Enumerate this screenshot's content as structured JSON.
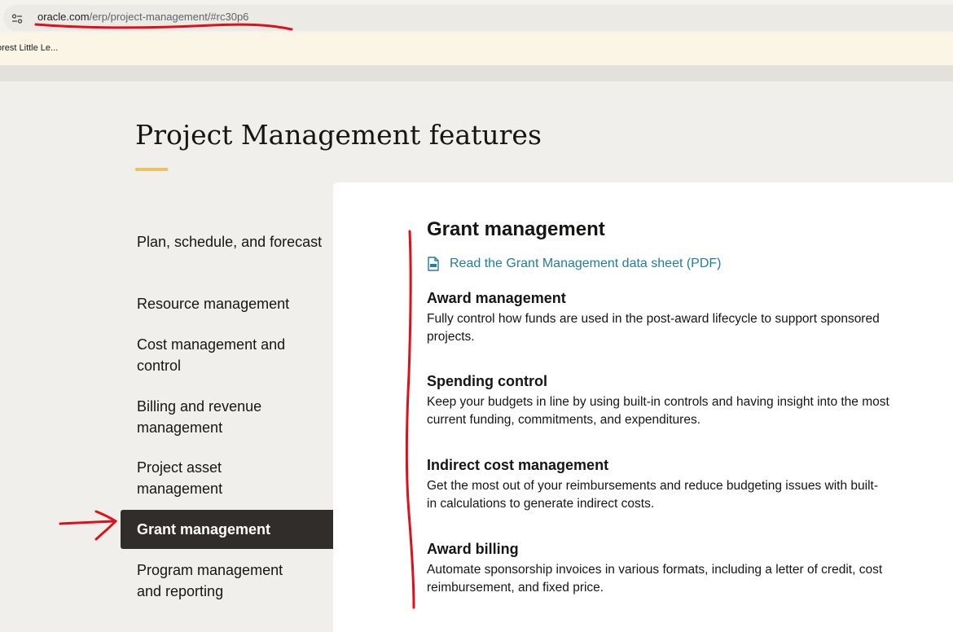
{
  "browser": {
    "url_host": "oracle.com",
    "url_path": "/erp/project-management/#rc30p6",
    "bookmark_label": "orest Little Le..."
  },
  "page": {
    "title": "Project Management features",
    "accent_color": "#e9c460"
  },
  "nav": {
    "items": [
      {
        "label": "Plan, schedule, and forecast",
        "active": false
      },
      {
        "label": "Resource management",
        "active": false
      },
      {
        "label": "Cost management and control",
        "active": false
      },
      {
        "label": "Billing and revenue management",
        "active": false
      },
      {
        "label": "Project asset management",
        "active": false
      },
      {
        "label": "Grant management",
        "active": true
      },
      {
        "label": "Program management and reporting",
        "active": false
      }
    ],
    "active_bg_color": "#312d2a"
  },
  "panel": {
    "title": "Grant management",
    "pdf_link": {
      "label": "Read the Grant Management data sheet (PDF)",
      "icon": "pdf-document-icon",
      "color": "#227e9e"
    },
    "sections": [
      {
        "heading": "Award management",
        "body": "Fully control how funds are used in the post-award lifecycle to support sponsored projects."
      },
      {
        "heading": "Spending control",
        "body": "Keep your budgets in line by using built-in controls and having insight into the most current funding, commitments, and expenditures."
      },
      {
        "heading": "Indirect cost management",
        "body": "Get the most out of your reimbursements and reduce budgeting issues with built-in calculations to generate indirect costs."
      },
      {
        "heading": "Award billing",
        "body": "Automate sponsorship invoices in various formats, including a letter of credit, cost reimbursement, and fixed price."
      }
    ]
  },
  "annotations": {
    "color": "#e0101a"
  }
}
